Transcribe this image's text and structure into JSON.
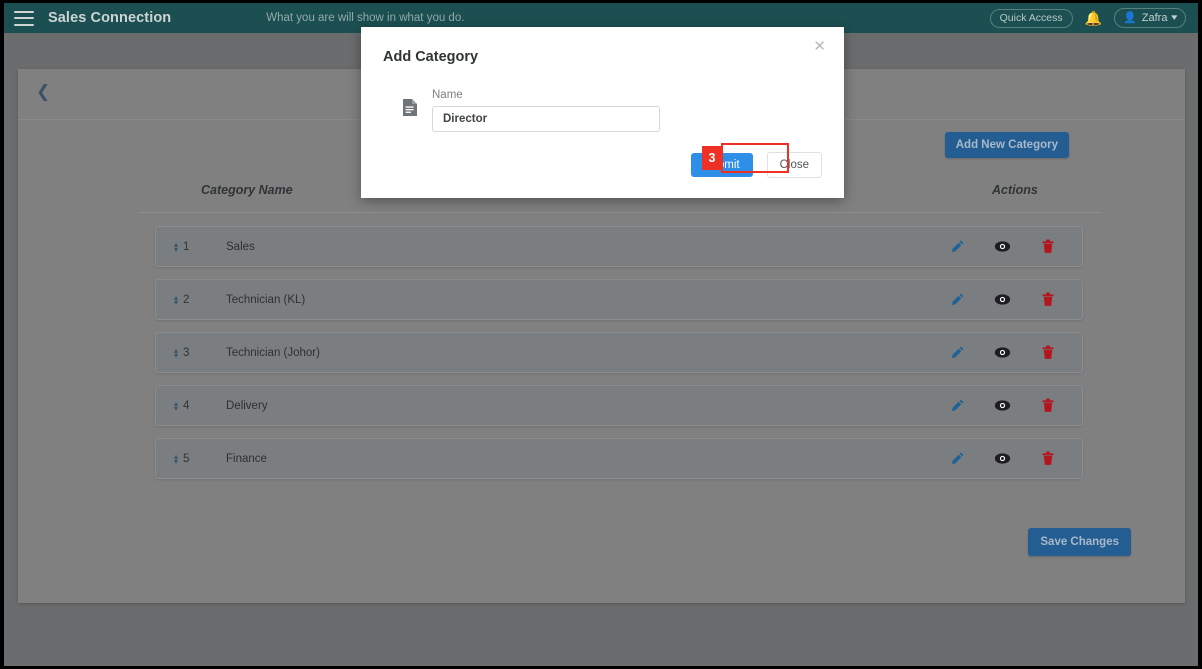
{
  "navbar": {
    "menu_icon": "hamburger-icon",
    "brand": "Sales Connection",
    "tagline": "What you are will show in what you do.",
    "quick_access": "Quick Access",
    "bell_icon": "bell-icon",
    "user_name": "Zafra",
    "avatar_icon": "user-icon",
    "caret_icon": "chevron-down-icon",
    "background": "#1c4f51"
  },
  "page": {
    "back_icon": "chevron-left-icon",
    "add_new_category": "Add New Category",
    "save_changes": "Save Changes",
    "accent_button": "#235d92"
  },
  "table": {
    "columns": [
      "Category Name",
      "Actions"
    ],
    "rows": [
      {
        "order": "1",
        "name": "Sales"
      },
      {
        "order": "2",
        "name": "Technician (KL)"
      },
      {
        "order": "3",
        "name": "Technician (Johor)"
      },
      {
        "order": "4",
        "name": "Delivery"
      },
      {
        "order": "5",
        "name": "Finance"
      }
    ],
    "action_icons": [
      "edit-pencil-icon",
      "view-eye-icon",
      "delete-trash-icon"
    ],
    "edit_color": "#1f6296",
    "view_color": "#1c1c22",
    "delete_color": "#b3151f"
  },
  "modal": {
    "title": "Add Category",
    "close_icon": "close-x-icon",
    "field_icon": "document-icon",
    "name_label": "Name",
    "name_value": "Director",
    "name_placeholder": "",
    "submit_label": "Submit",
    "close_label": "Close",
    "submit_color": "#2d8fe8"
  },
  "annotation": {
    "step_number": "3",
    "highlight_color": "#ee3124"
  }
}
